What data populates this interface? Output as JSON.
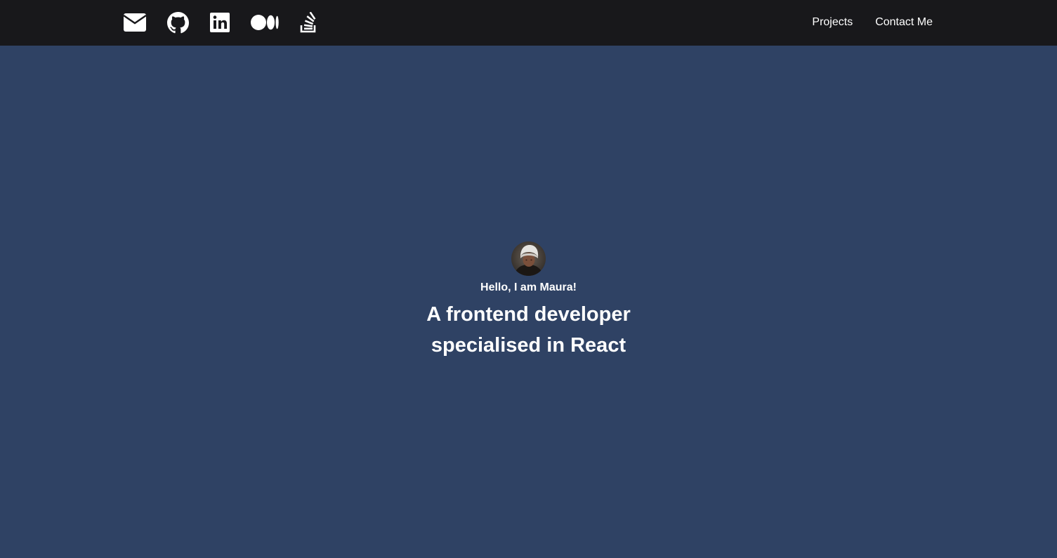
{
  "header": {
    "social_links": [
      {
        "icon": "envelope-icon",
        "label": "Email"
      },
      {
        "icon": "github-icon",
        "label": "GitHub"
      },
      {
        "icon": "linkedin-icon",
        "label": "LinkedIn"
      },
      {
        "icon": "medium-icon",
        "label": "Medium"
      },
      {
        "icon": "stackoverflow-icon",
        "label": "Stack Overflow"
      }
    ],
    "nav": [
      {
        "label": "Projects"
      },
      {
        "label": "Contact Me"
      }
    ]
  },
  "hero": {
    "greeting": "Hello, I am Maura!",
    "headline_lines": [
      "A frontend developer",
      "specialised in React"
    ]
  },
  "colors": {
    "header_bg": "#18181b",
    "hero_bg": "#2f4264",
    "text": "#ffffff"
  }
}
